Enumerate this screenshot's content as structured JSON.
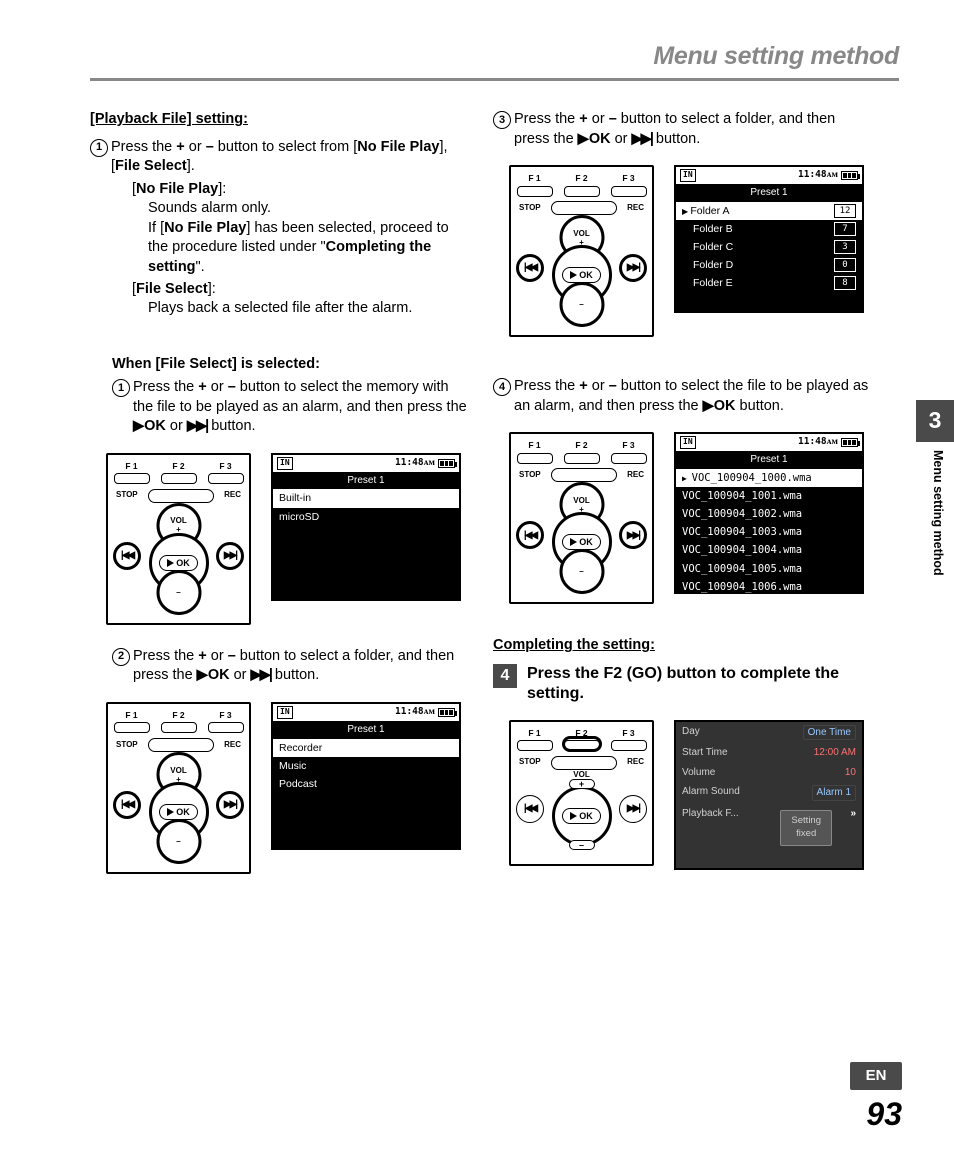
{
  "header": {
    "title": "Menu setting method"
  },
  "side": {
    "chapter_no": "3",
    "vtext": "Menu setting method",
    "lang": "EN",
    "page_no": "93"
  },
  "device": {
    "f1": "F 1",
    "f2": "F 2",
    "f3": "F 3",
    "stop": "STOP",
    "rec": "REC",
    "vol": "VOL",
    "plus": "+",
    "minus": "–",
    "ok": "OK"
  },
  "screens": {
    "time": "11:48ᴀᴍ",
    "in": "IN",
    "preset_title": "Preset 1",
    "mem": {
      "items": [
        "Built-in",
        "microSD"
      ]
    },
    "cat": {
      "items": [
        "Recorder",
        "Music",
        "Podcast"
      ]
    },
    "folders": {
      "items": [
        {
          "name": "Folder A",
          "count": "12"
        },
        {
          "name": "Folder B",
          "count": "7"
        },
        {
          "name": "Folder C",
          "count": "3"
        },
        {
          "name": "Folder D",
          "count": "0"
        },
        {
          "name": "Folder E",
          "count": "8"
        }
      ]
    },
    "files": {
      "items": [
        "VOC_100904_1000.wma",
        "VOC_100904_1001.wma",
        "VOC_100904_1002.wma",
        "VOC_100904_1003.wma",
        "VOC_100904_1004.wma",
        "VOC_100904_1005.wma",
        "VOC_100904_1006.wma"
      ]
    },
    "settings": {
      "rows": [
        {
          "k": "Day",
          "v": "One Time"
        },
        {
          "k": "Start Time",
          "v": "12:00 AM"
        },
        {
          "k": "Volume",
          "v": "10"
        },
        {
          "k": "Alarm Sound",
          "v": "Alarm 1"
        },
        {
          "k": "Playback F...",
          "v": ""
        }
      ],
      "toast": "Setting\nfixed",
      "arrow": "»"
    }
  },
  "left": {
    "playback_heading": "[Playback File] setting:",
    "p1_a": "Press the ",
    "p1_b": " or ",
    "p1_c": " button to select from [",
    "p1_no_file_play": "No File Play",
    "p1_d": "], [",
    "p1_file_select": "File Select",
    "p1_e": "].",
    "nfp_label": "No File Play",
    "nfp_open": "[",
    "nfp_close": "]:",
    "nfp_body1": "Sounds alarm only.",
    "nfp_body2a": "If [",
    "nfp_body2b": "] has been selected, proceed to the procedure listed under \"",
    "nfp_body2c": "\".",
    "complete_ref": "Completing the setting",
    "fs_label": "File Select",
    "fs_open": "[",
    "fs_close": "]:",
    "fs_body": "Plays back a selected file after the alarm.",
    "when_heading": "When [File Select] is selected:",
    "s1_a": "Press the ",
    "s1_b": " or ",
    "s1_c": " button to select the memory with the file to be played as an alarm, and then press the ",
    "s1_d": " or ",
    "s1_e": " button.",
    "s2_a": "Press the ",
    "s2_b": " or ",
    "s2_c": " button to select a folder, and then press the ",
    "s2_d": " or ",
    "s2_e": " button.",
    "plus": "+",
    "minus": "–",
    "ok": "▶OK",
    "ff": "▶▶|"
  },
  "right": {
    "s3_a": "Press the ",
    "s3_b": " or ",
    "s3_c": " button to select a folder, and then press the ",
    "s3_d": " or ",
    "s3_e": " button.",
    "s4_a": "Press the ",
    "s4_b": " or ",
    "s4_c": " button to select the file to be played as an alarm, and then press the ",
    "s4_d": "  button.",
    "complete_heading": "Completing the setting:",
    "step4_no": "4",
    "step4_txt_a": "Press the ",
    "step4_f2": "F2 (GO)",
    "step4_txt_b": " button to complete the setting.",
    "plus": "+",
    "minus": "–",
    "ok": "▶OK",
    "ff": "▶▶|"
  }
}
